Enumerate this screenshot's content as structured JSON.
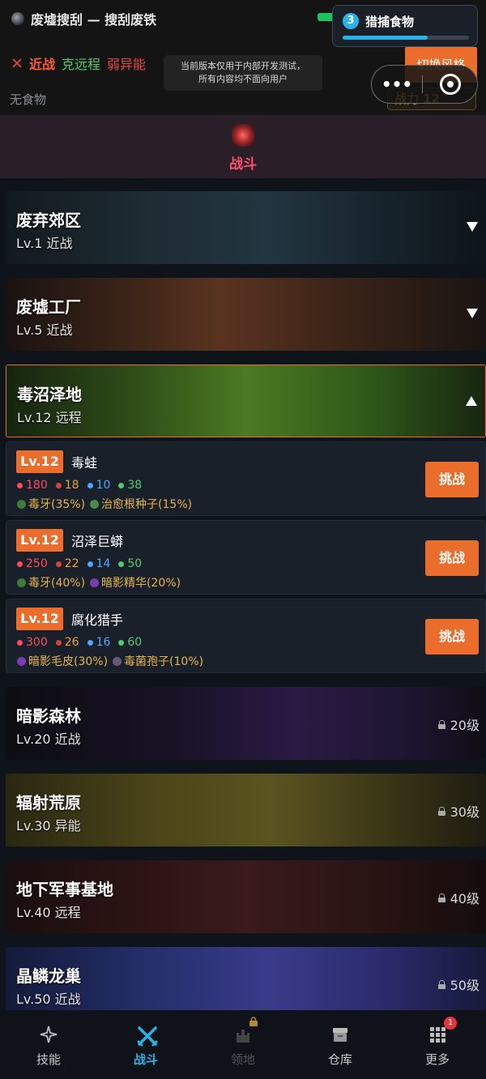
{
  "app": {
    "title": "废墟搜刮 — 搜刮废铁"
  },
  "quest": {
    "number": "3",
    "label": "猎捕食物",
    "progress": 0.67
  },
  "header": {
    "class_melee": "近战",
    "class_ranged": "克远程",
    "class_psi": "弱异能",
    "notice_line1": "当前版本仅用于内部开发测试，",
    "notice_line2": "所有内容均不面向用户",
    "food": "无食物",
    "switch_style": "切换风格",
    "power": "战力 12"
  },
  "battle": {
    "label": "战斗"
  },
  "zones": [
    {
      "name": "废弃郊区",
      "info": "Lv.1  近战"
    },
    {
      "name": "废墟工厂",
      "info": "Lv.5  近战"
    },
    {
      "name": "毒沼泽地",
      "info": "Lv.12  远程"
    },
    {
      "name": "暗影森林",
      "info": "Lv.20  近战",
      "lock": "20级"
    },
    {
      "name": "辐射荒原",
      "info": "Lv.30  异能",
      "lock": "30级"
    },
    {
      "name": "地下军事基地",
      "info": "Lv.40  远程",
      "lock": "40级"
    },
    {
      "name": "晶鳞龙巢",
      "info": "Lv.50  近战",
      "lock": "50级"
    }
  ],
  "monsters": [
    {
      "level": "Lv.12",
      "name": "毒蛙",
      "hp": "180",
      "atk": "18",
      "def": "10",
      "spd": "38",
      "drop1": "毒牙(35%)",
      "drop2": "治愈根种子(15%)",
      "challenge": "挑战"
    },
    {
      "level": "Lv.12",
      "name": "沼泽巨蟒",
      "hp": "250",
      "atk": "22",
      "def": "14",
      "spd": "50",
      "drop1": "毒牙(40%)",
      "drop2": "暗影精华(20%)",
      "challenge": "挑战"
    },
    {
      "level": "Lv.12",
      "name": "腐化猎手",
      "hp": "300",
      "atk": "26",
      "def": "16",
      "spd": "60",
      "drop1": "暗影毛皮(30%)",
      "drop2": "毒菌孢子(10%)",
      "challenge": "挑战"
    }
  ],
  "nav": {
    "skills": "技能",
    "battle": "战斗",
    "territory": "领地",
    "warehouse": "仓库",
    "more": "更多",
    "more_badge": "1"
  },
  "colors": {
    "accent": "#ea6d2c",
    "active": "#27b3e8",
    "battle": "#ff4f6e"
  }
}
